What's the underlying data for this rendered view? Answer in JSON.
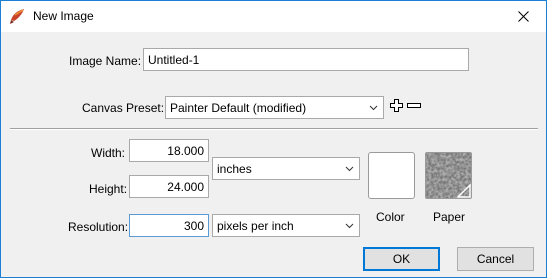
{
  "window": {
    "title": "New Image"
  },
  "form": {
    "image_name_label": "Image Name:",
    "image_name_value": "Untitled-1",
    "canvas_preset_label": "Canvas Preset:",
    "canvas_preset_value": "Painter Default (modified)",
    "width_label": "Width:",
    "width_value": "18.000",
    "height_label": "Height:",
    "height_value": "24.000",
    "size_unit_value": "inches",
    "resolution_label": "Resolution:",
    "resolution_value": "300",
    "resolution_unit_value": "pixels per inch",
    "color_label": "Color",
    "paper_label": "Paper",
    "color_swatch": "#ffffff"
  },
  "buttons": {
    "ok_label": "OK",
    "cancel_label": "Cancel"
  },
  "icons": {
    "app": "painter-brush-icon",
    "close": "close-icon",
    "add": "plus-icon",
    "remove": "minus-icon",
    "chevron": "chevron-down-icon"
  }
}
